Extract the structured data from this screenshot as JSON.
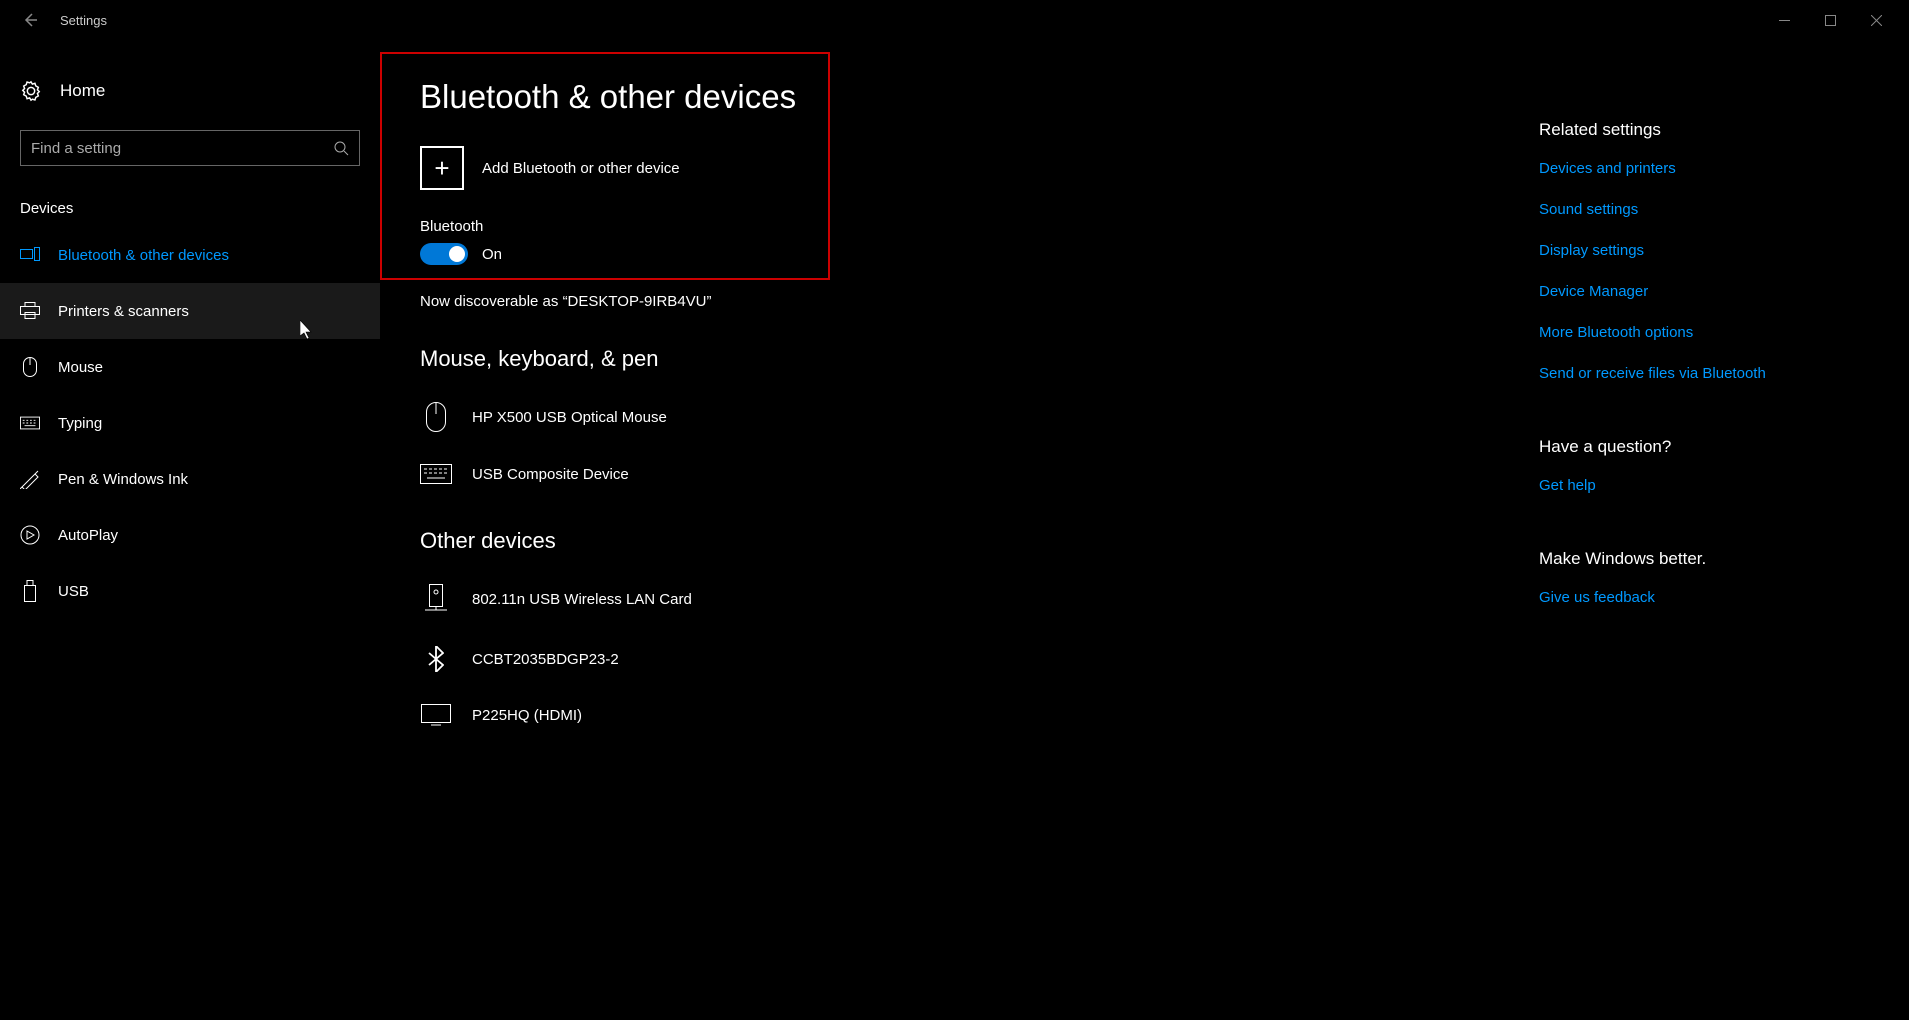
{
  "window": {
    "title": "Settings"
  },
  "sidebar": {
    "home_label": "Home",
    "search_placeholder": "Find a setting",
    "group_label": "Devices",
    "items": [
      {
        "label": "Bluetooth & other devices"
      },
      {
        "label": "Printers & scanners"
      },
      {
        "label": "Mouse"
      },
      {
        "label": "Typing"
      },
      {
        "label": "Pen & Windows Ink"
      },
      {
        "label": "AutoPlay"
      },
      {
        "label": "USB"
      }
    ]
  },
  "main": {
    "title": "Bluetooth & other devices",
    "add_device_label": "Add Bluetooth or other device",
    "bluetooth_label": "Bluetooth",
    "toggle_state": "On",
    "discoverable_text": "Now discoverable as “DESKTOP-9IRB4VU”",
    "section1_title": "Mouse, keyboard, & pen",
    "devices1": [
      {
        "name": "HP X500 USB Optical Mouse"
      },
      {
        "name": "USB Composite Device"
      }
    ],
    "section2_title": "Other devices",
    "devices2": [
      {
        "name": "802.11n USB Wireless LAN Card"
      },
      {
        "name": "CCBT2035BDGP23-2"
      },
      {
        "name": "P225HQ (HDMI)"
      }
    ]
  },
  "right": {
    "related_heading": "Related settings",
    "related_links": [
      "Devices and printers",
      "Sound settings",
      "Display settings",
      "Device Manager",
      "More Bluetooth options",
      "Send or receive files via Bluetooth"
    ],
    "question_heading": "Have a question?",
    "help_link": "Get help",
    "better_heading": "Make Windows better.",
    "feedback_link": "Give us feedback"
  }
}
